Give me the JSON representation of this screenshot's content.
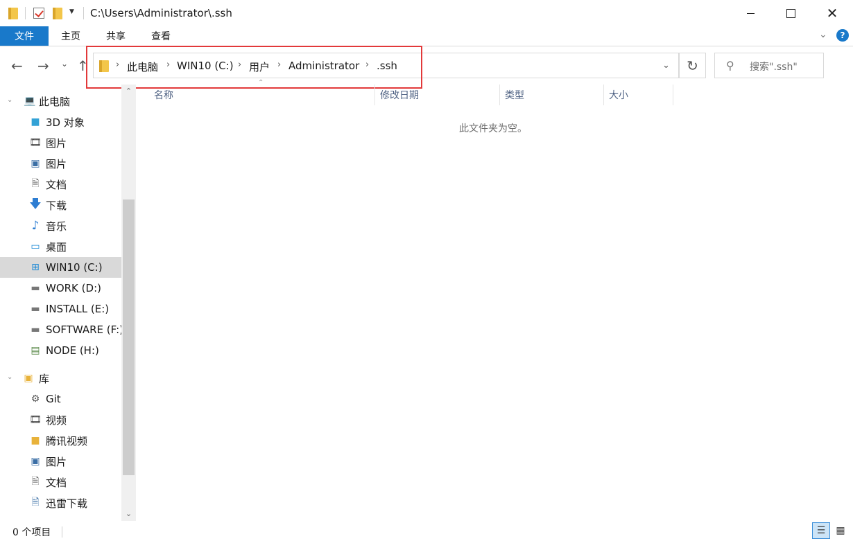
{
  "window": {
    "title": "C:\\Users\\Administrator\\.ssh"
  },
  "ribbon": {
    "tabs": [
      "文件",
      "主页",
      "共享",
      "查看"
    ]
  },
  "address": {
    "crumbs": [
      "此电脑",
      "WIN10 (C:)",
      "用户",
      "Administrator",
      ".ssh"
    ]
  },
  "search": {
    "placeholder": "搜索\".ssh\""
  },
  "sidebar": {
    "items": [
      {
        "label": "此电脑",
        "icon": "computer-icon"
      },
      {
        "label": "3D 对象",
        "icon": "cube-icon"
      },
      {
        "label": "图片",
        "icon": "video-film-icon"
      },
      {
        "label": "图片",
        "icon": "pictures-icon"
      },
      {
        "label": "文档",
        "icon": "document-icon"
      },
      {
        "label": "下载",
        "icon": "download-arrow-icon"
      },
      {
        "label": "音乐",
        "icon": "music-note-icon"
      },
      {
        "label": "桌面",
        "icon": "desktop-icon"
      },
      {
        "label": "WIN10 (C:)",
        "icon": "system-drive-icon"
      },
      {
        "label": "WORK (D:)",
        "icon": "drive-icon"
      },
      {
        "label": "INSTALL (E:)",
        "icon": "drive-icon"
      },
      {
        "label": "SOFTWARE (F:)",
        "icon": "drive-icon"
      },
      {
        "label": "NODE (H:)",
        "icon": "network-drive-icon"
      },
      {
        "label": "库",
        "icon": "library-icon"
      },
      {
        "label": "Git",
        "icon": "git-icon"
      },
      {
        "label": "视频",
        "icon": "video-film-icon"
      },
      {
        "label": "腾讯视频",
        "icon": "folder-icon"
      },
      {
        "label": "图片",
        "icon": "pictures-icon"
      },
      {
        "label": "文档",
        "icon": "document-icon"
      },
      {
        "label": "迅雷下载",
        "icon": "download-folder-icon"
      }
    ],
    "selected": "WIN10 (C:)"
  },
  "columns": [
    "名称",
    "修改日期",
    "类型",
    "大小"
  ],
  "content": {
    "empty_message": "此文件夹为空。"
  },
  "status": {
    "item_count": "0 个项目"
  },
  "colors": {
    "file_tab": "#1979ca",
    "annotation": "#e2393a",
    "selected_row": "#d9d9d9"
  }
}
